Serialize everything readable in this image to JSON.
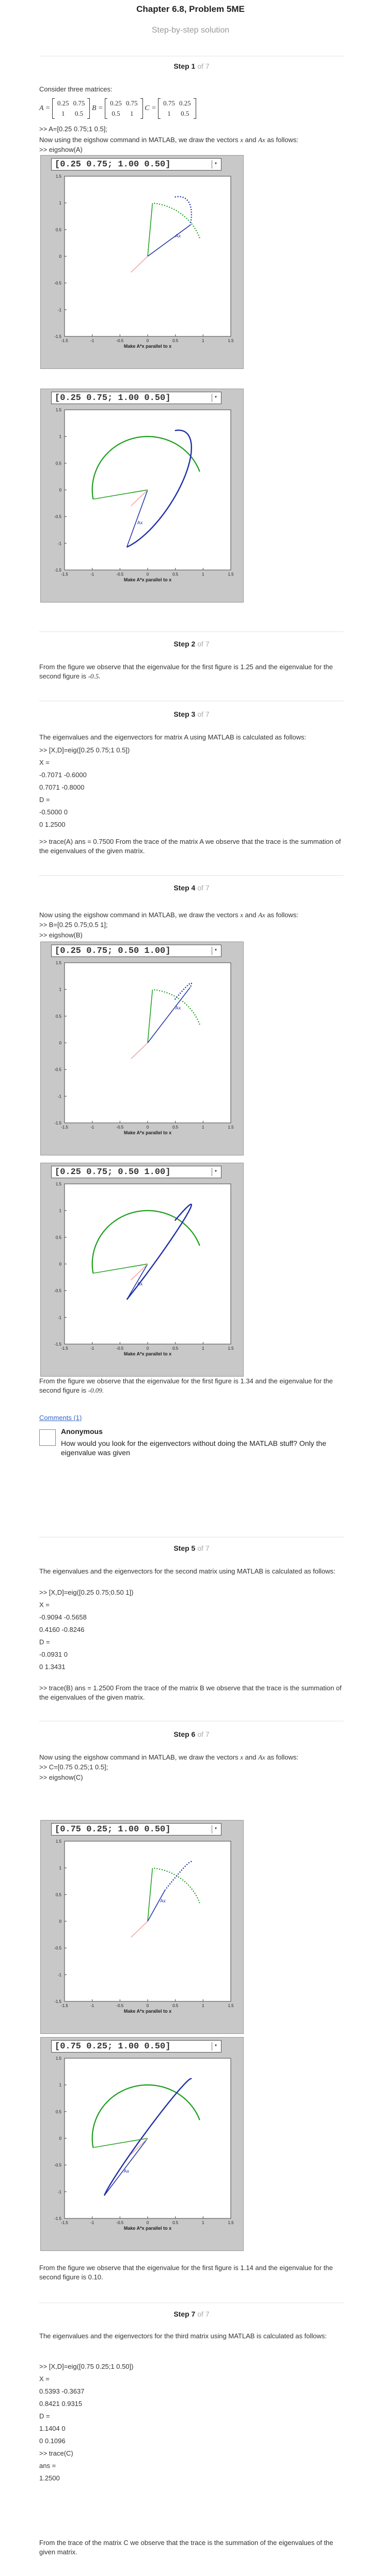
{
  "header": {
    "title": "Chapter 6.8, Problem 5ME",
    "subtitle": "Step-by-step solution"
  },
  "steps": [
    {
      "label": "Step 1",
      "of": "of 7"
    },
    {
      "label": "Step 2",
      "of": "of 7"
    },
    {
      "label": "Step 3",
      "of": "of 7"
    },
    {
      "label": "Step 4",
      "of": "of 7"
    },
    {
      "label": "Step 5",
      "of": "of 7"
    },
    {
      "label": "Step 6",
      "of": "of 7"
    },
    {
      "label": "Step 7",
      "of": "of 7"
    }
  ],
  "step1": {
    "intro": "Consider three matrices:",
    "matrices": {
      "A_label": "A =",
      "A": [
        [
          "0.25",
          "0.75"
        ],
        [
          "1",
          "0.5"
        ]
      ],
      "B_label": "B =",
      "B": [
        [
          "0.25",
          "0.75"
        ],
        [
          "0.5",
          "1"
        ]
      ],
      "C_label": "C =",
      "C": [
        [
          "0.75",
          "0.25"
        ],
        [
          "1",
          "0.5"
        ]
      ]
    },
    "cmd_A": ">> A=[0.25 0.75;1 0.5];",
    "eigshow_text": "Now using the eigshow command in MATLAB, we draw the vectors",
    "x_sym": "x",
    "and": "and",
    "ax_sym": "Ax",
    "as_follows": "as follows:",
    "cmd_eigshow": ">> eigshow(A)"
  },
  "figures": [
    {
      "dropdown": "[0.25 0.75; 1.00 0.50]",
      "xlabel": "Make A*x parallel to x",
      "marker": "Ax",
      "mode": "x"
    },
    {
      "dropdown": "[0.25 0.75; 1.00 0.50]",
      "xlabel": "Make A*x parallel to x",
      "marker": "Ax",
      "mode": "ax"
    },
    {
      "dropdown": "[0.25 0.75; 0.50 1.00]",
      "xlabel": "Make A*x parallel to x",
      "marker": "Ax",
      "mode": "x"
    },
    {
      "dropdown": "[0.25 0.75; 0.50 1.00]",
      "xlabel": "Make A*x parallel to x",
      "marker": "Ax",
      "mode": "ax"
    },
    {
      "dropdown": "[0.75 0.25; 1.00 0.50]",
      "xlabel": "Make A*x parallel to x",
      "marker": "Ax",
      "mode": "x"
    },
    {
      "dropdown": "[0.75 0.25; 1.00 0.50]",
      "xlabel": "Make A*x parallel to x",
      "marker": "Ax",
      "mode": "ax"
    }
  ],
  "ticks": {
    "y": [
      "1.5",
      "1",
      "0.5",
      "0",
      "-0.5",
      "-1",
      "-1.5"
    ],
    "x": [
      "-1.5",
      "-1",
      "-0.5",
      "0",
      "0.5",
      "1",
      "1.5"
    ]
  },
  "step2": {
    "text": "From the figure we observe that the eigenvalue for the first figure is 1.25 and the eigenvalue for the second figure is",
    "value": "-0.5."
  },
  "step3": {
    "text": "The eigenvalues and the eigenvectors for matrix A using MATLAB is calculated as follows:",
    "lines": [
      ">> [X,D]=eig([0.25 0.75;1 0.5])",
      "X =",
      "-0.7071 -0.6000",
      "0.7071 -0.8000",
      "D =",
      "-0.5000 0",
      "0 1.2500"
    ],
    "trace": ">> trace(A) ans = 0.7500 From the trace of the matrix A we observe that the trace is the summation of the eigenvalues of the given matrix."
  },
  "step4": {
    "eigshow_text": "Now using the eigshow command in MATLAB, we draw the vectors",
    "cmd_B": ">> B=[0.25 0.75;0.5 1];",
    "cmd_eigshow": ">> eigshow(B)",
    "result": "From the figure we observe that the eigenvalue for the first figure is 1.34 and the eigenvalue for the second figure is",
    "value": "-0.09."
  },
  "comments": {
    "link": "Comments (1)",
    "author": "Anonymous",
    "text": "How would you look for the eigenvectors without doing the MATLAB stuff? Only the eigenvalue was given"
  },
  "step5": {
    "text": "The eigenvalues and the eigenvectors for the second matrix using MATLAB is calculated as follows:",
    "lines": [
      ">> [X,D]=eig([0.25 0.75;0.50 1])",
      "X =",
      "-0.9094 -0.5658",
      "0.4160 -0.8246",
      "D =",
      "-0.0931 0",
      "0 1.3431"
    ],
    "trace": ">> trace(B) ans = 1.2500 From the trace of the matrix B we observe that the trace is the summation of the eigenvalues of the given matrix."
  },
  "step6": {
    "eigshow_text": "Now using the eigshow command in MATLAB, we draw the vectors",
    "cmd_C": ">> C=[0.75 0.25;1 0.5];",
    "cmd_eigshow": ">> eigshow(C)",
    "result": "From the figure we observe that the eigenvalue for the first figure is 1.14 and the eigenvalue for the second figure is 0.10."
  },
  "step7": {
    "text": "The eigenvalues and the eigenvectors for the third matrix using MATLAB is calculated as follows:",
    "lines": [
      ">> [X,D]=eig([0.75 0.25;1 0.50])",
      "X =",
      "0.5393 -0.3637",
      "0.8421 0.9315",
      "D =",
      "1.1404 0",
      "0 0.1096",
      ">> trace(C)",
      "ans =",
      "1.2500"
    ],
    "trace": "From the trace of the matrix C we observe that the trace is the summation of the eigenvalues of the given matrix."
  }
}
